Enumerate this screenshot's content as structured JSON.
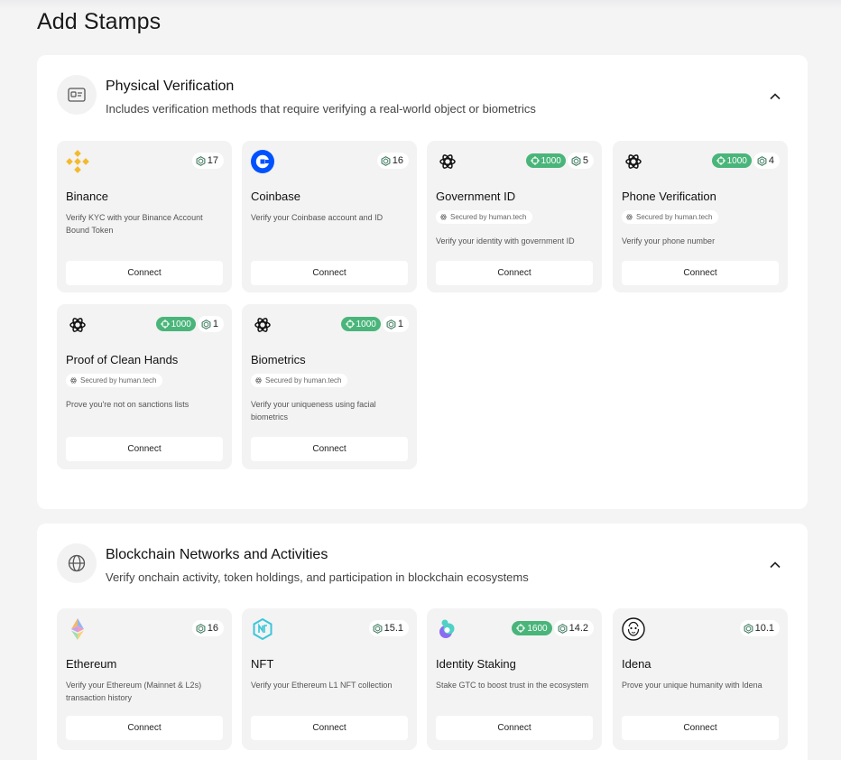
{
  "page": {
    "title": "Add Stamps"
  },
  "colors": {
    "accent": "#4ab57a",
    "card_bg": "#f3f3f4",
    "page_bg": "#f4f4f5"
  },
  "sections": [
    {
      "title": "Physical Verification",
      "description": "Includes verification methods that require verifying a real-world object or biometrics",
      "icon": "id-card-icon",
      "cards": [
        {
          "name": "Binance",
          "logo": "binance-icon",
          "score": "17",
          "boost": null,
          "secured": null,
          "description": "Verify KYC with your Binance Account Bound Token",
          "button": "Connect"
        },
        {
          "name": "Coinbase",
          "logo": "coinbase-icon",
          "score": "16",
          "boost": null,
          "secured": null,
          "description": "Verify your Coinbase account and ID",
          "button": "Connect"
        },
        {
          "name": "Government ID",
          "logo": "human-tech-icon",
          "score": "5",
          "boost": "1000",
          "secured": "Secured by human.tech",
          "description": "Verify your identity with government ID",
          "button": "Connect"
        },
        {
          "name": "Phone Verification",
          "logo": "human-tech-icon",
          "score": "4",
          "boost": "1000",
          "secured": "Secured by human.tech",
          "description": "Verify your phone number",
          "button": "Connect"
        },
        {
          "name": "Proof of Clean Hands",
          "logo": "human-tech-icon",
          "score": "1",
          "boost": "1000",
          "secured": "Secured by human.tech",
          "description": "Prove you're not on sanctions lists",
          "button": "Connect"
        },
        {
          "name": "Biometrics",
          "logo": "human-tech-icon",
          "score": "1",
          "boost": "1000",
          "secured": "Secured by human.tech",
          "description": "Verify your uniqueness using facial biometrics",
          "button": "Connect"
        }
      ]
    },
    {
      "title": "Blockchain Networks and Activities",
      "description": "Verify onchain activity, token holdings, and participation in blockchain ecosystems",
      "icon": "globe-icon",
      "cards": [
        {
          "name": "Ethereum",
          "logo": "ethereum-icon",
          "score": "16",
          "boost": null,
          "secured": null,
          "description": "Verify your Ethereum (Mainnet & L2s) transaction history",
          "button": "Connect"
        },
        {
          "name": "NFT",
          "logo": "nft-icon",
          "score": "15.1",
          "boost": null,
          "secured": null,
          "description": "Verify your Ethereum L1 NFT collection",
          "button": "Connect"
        },
        {
          "name": "Identity Staking",
          "logo": "identity-staking-icon",
          "score": "14.2",
          "boost": "1600",
          "secured": null,
          "description": "Stake GTC to boost trust in the ecosystem",
          "button": "Connect"
        },
        {
          "name": "Idena",
          "logo": "idena-icon",
          "score": "10.1",
          "boost": null,
          "secured": null,
          "description": "Prove your unique humanity with Idena",
          "button": "Connect"
        }
      ]
    }
  ]
}
